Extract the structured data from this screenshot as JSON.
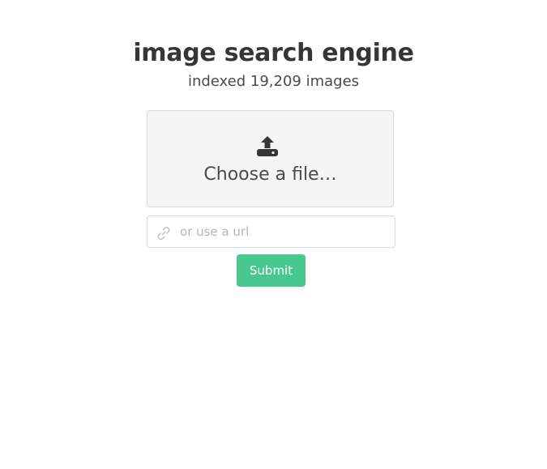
{
  "header": {
    "title": "image search engine",
    "subtitle": "indexed 19,209 images"
  },
  "upload": {
    "icon": "upload-icon",
    "label": "Choose a file…"
  },
  "url_field": {
    "icon": "link-icon",
    "placeholder": "or use a url",
    "value": ""
  },
  "submit": {
    "label": "Submit",
    "color": "#48c78e"
  },
  "colors": {
    "text": "#363636",
    "file_box_bg": "#f5f5f5",
    "border": "#dbdbdb",
    "placeholder": "#b5b5b5"
  }
}
